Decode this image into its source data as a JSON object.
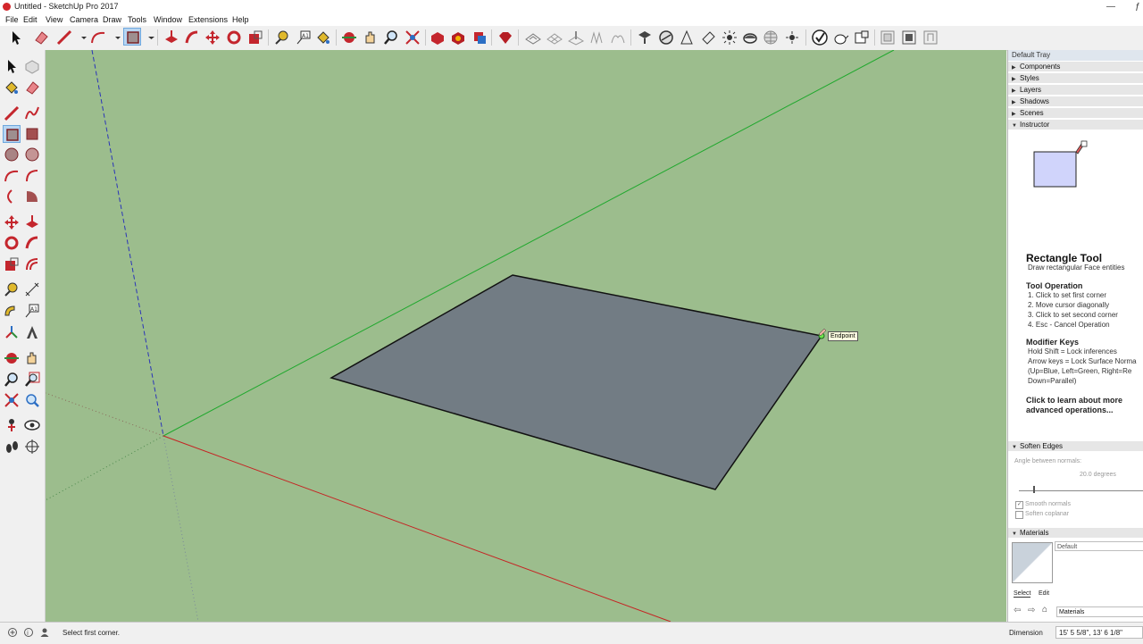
{
  "window": {
    "title": "Untitled - SketchUp Pro 2017",
    "minimize": "—",
    "restore": "ƒ"
  },
  "menu": [
    "File",
    "Edit",
    "View",
    "Camera",
    "Draw",
    "Tools",
    "Window",
    "Extensions",
    "Help"
  ],
  "toolbar_icons": [
    "select-icon",
    "eraser-icon",
    "line-icon",
    "dropdown-arrow-icon",
    "arc-icon",
    "dropdown-arrow-icon",
    "rectangle-icon",
    "dropdown-arrow-icon",
    "push-pull-icon",
    "follow-me-icon",
    "move-icon",
    "rotate-icon",
    "scale-icon",
    "tape-measure-icon",
    "text-icon",
    "paint-bucket-icon",
    "orbit-icon",
    "pan-icon",
    "zoom-icon",
    "zoom-extents-icon",
    "3d-warehouse-icon",
    "extension-warehouse-icon",
    "layout-icon",
    "ruby-console-icon",
    "sandbox-from-contours-icon",
    "sandbox-from-scratch-icon",
    "smoove-icon",
    "stamp-icon",
    "drape-icon",
    "add-location-icon",
    "toggle-terrain-icon",
    "section-plane-icon",
    "display-section-planes-icon",
    "display-section-cuts-icon",
    "shadows-icon",
    "fog-icon",
    "match-photo-icon",
    "solid-inspector-icon",
    "teapot-icon",
    "model-info-icon",
    "outer-shell-icon",
    "intersect-icon",
    "union-icon"
  ],
  "tray": {
    "title": "Default Tray",
    "panels": [
      "Components",
      "Styles",
      "Layers",
      "Shadows",
      "Scenes",
      "Instructor"
    ],
    "instructor": {
      "tool_name": "Rectangle Tool",
      "description": "Draw rectangular Face entities",
      "operation_heading": "Tool Operation",
      "operation_steps": [
        "1. Click to set first corner",
        "2. Move cursor diagonally",
        "3. Click to set second corner",
        "4. Esc - Cancel Operation"
      ],
      "modifier_heading": "Modifier Keys",
      "modifier_lines": [
        "Hold Shift = Lock inferences",
        "Arrow keys = Lock Surface Norma",
        "(Up=Blue, Left=Green, Right=Re",
        "Down=Parallel)"
      ],
      "more_link": "Click to learn about more advanced operations..."
    },
    "soften_edges": {
      "title": "Soften Edges",
      "angle_label": "Angle between normals:",
      "angle_value": "20.0 degrees",
      "smooth_normals": "Smooth normals",
      "soften_coplanar": "Soften coplanar",
      "smooth_checked": "✓"
    },
    "materials": {
      "title": "Materials",
      "current_name": "Default",
      "tab_select": "Select",
      "tab_edit": "Edit",
      "library": "Materials"
    }
  },
  "viewport": {
    "inference_tooltip": "Endpoint"
  },
  "statusbar": {
    "message": "Select first corner.",
    "measurement_label": "Dimension",
    "measurement_value": "15' 5 5/8\", 13' 6 1/8\""
  }
}
